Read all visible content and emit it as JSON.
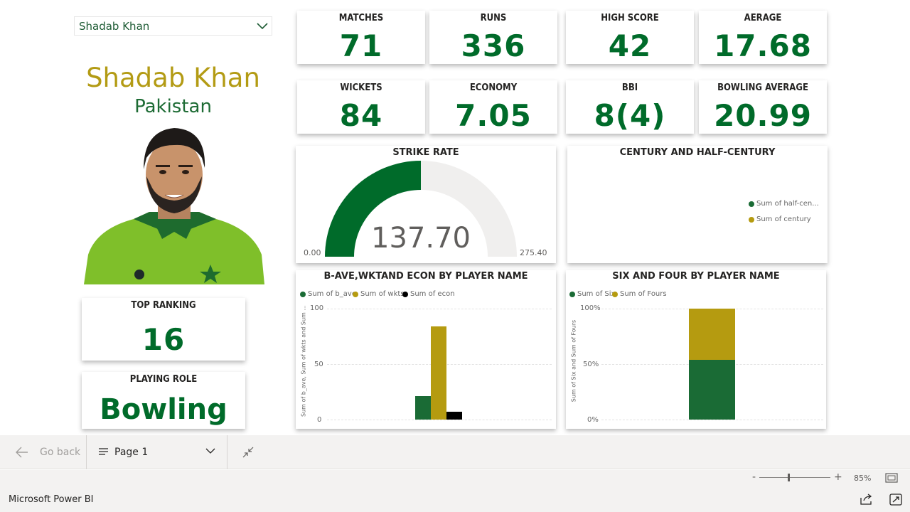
{
  "slicer": {
    "selected": "Shadab Khan"
  },
  "player": {
    "name": "Shadab Khan",
    "country": "Pakistan"
  },
  "kpis_row1": [
    {
      "title": "MATCHES",
      "value": "71"
    },
    {
      "title": "RUNS",
      "value": "336"
    },
    {
      "title": "HIGH SCORE",
      "value": "42"
    },
    {
      "title": "AERAGE",
      "value": "17.68"
    }
  ],
  "kpis_row2": [
    {
      "title": "WICKETS",
      "value": "84"
    },
    {
      "title": "ECONOMY",
      "value": "7.05"
    },
    {
      "title": "BBI",
      "value": "8(4)"
    },
    {
      "title": "BOWLING AVERAGE",
      "value": "20.99"
    }
  ],
  "top_ranking": {
    "title": "TOP RANKING",
    "value": "16"
  },
  "playing_role": {
    "title": "PLAYING ROLE",
    "value": "Bowling ..."
  },
  "strike_rate": {
    "title": "STRIKE RATE",
    "value": "137.70",
    "min": "0.00",
    "max": "275.40"
  },
  "century_chart": {
    "title": "CENTURY AND HALF-CENTURY",
    "legend": [
      "Sum of half-cen...",
      "Sum of century"
    ]
  },
  "colors": {
    "green": "#1a6b35",
    "gold": "#b59b10",
    "black": "#000000",
    "kpi_green": "#006b2a",
    "player_gold": "#b39b14"
  },
  "chart_data": [
    {
      "type": "bar",
      "title": "B-AVE,WKTAND ECON BY PLAYER NAME",
      "ylabel": "Sum of b_ave, Sum of wkts and Sum ...",
      "yticks": [
        "100",
        "50",
        "0"
      ],
      "ylim": [
        0,
        100
      ],
      "series": [
        {
          "name": "Sum of b_ave",
          "values": [
            21
          ]
        },
        {
          "name": "Sum of wkts",
          "values": [
            84
          ]
        },
        {
          "name": "Sum of econ",
          "values": [
            7.05
          ]
        }
      ]
    },
    {
      "type": "bar",
      "title": "SIX AND FOUR BY PLAYER NAME",
      "ylabel": "Sum of Six and Sum of Fours",
      "yticks": [
        "100%",
        "50%",
        "0%"
      ],
      "ylim": [
        0,
        1
      ],
      "stacked": "100%",
      "series": [
        {
          "name": "Sum of Six",
          "values": [
            0.54
          ]
        },
        {
          "name": "Sum of Fours",
          "values": [
            0.46
          ]
        }
      ]
    }
  ],
  "footer": {
    "go_back": "Go back",
    "page": "Page 1",
    "zoom": "85%",
    "app": "Microsoft Power BI",
    "zoom_minus": "-",
    "zoom_plus": "+"
  }
}
